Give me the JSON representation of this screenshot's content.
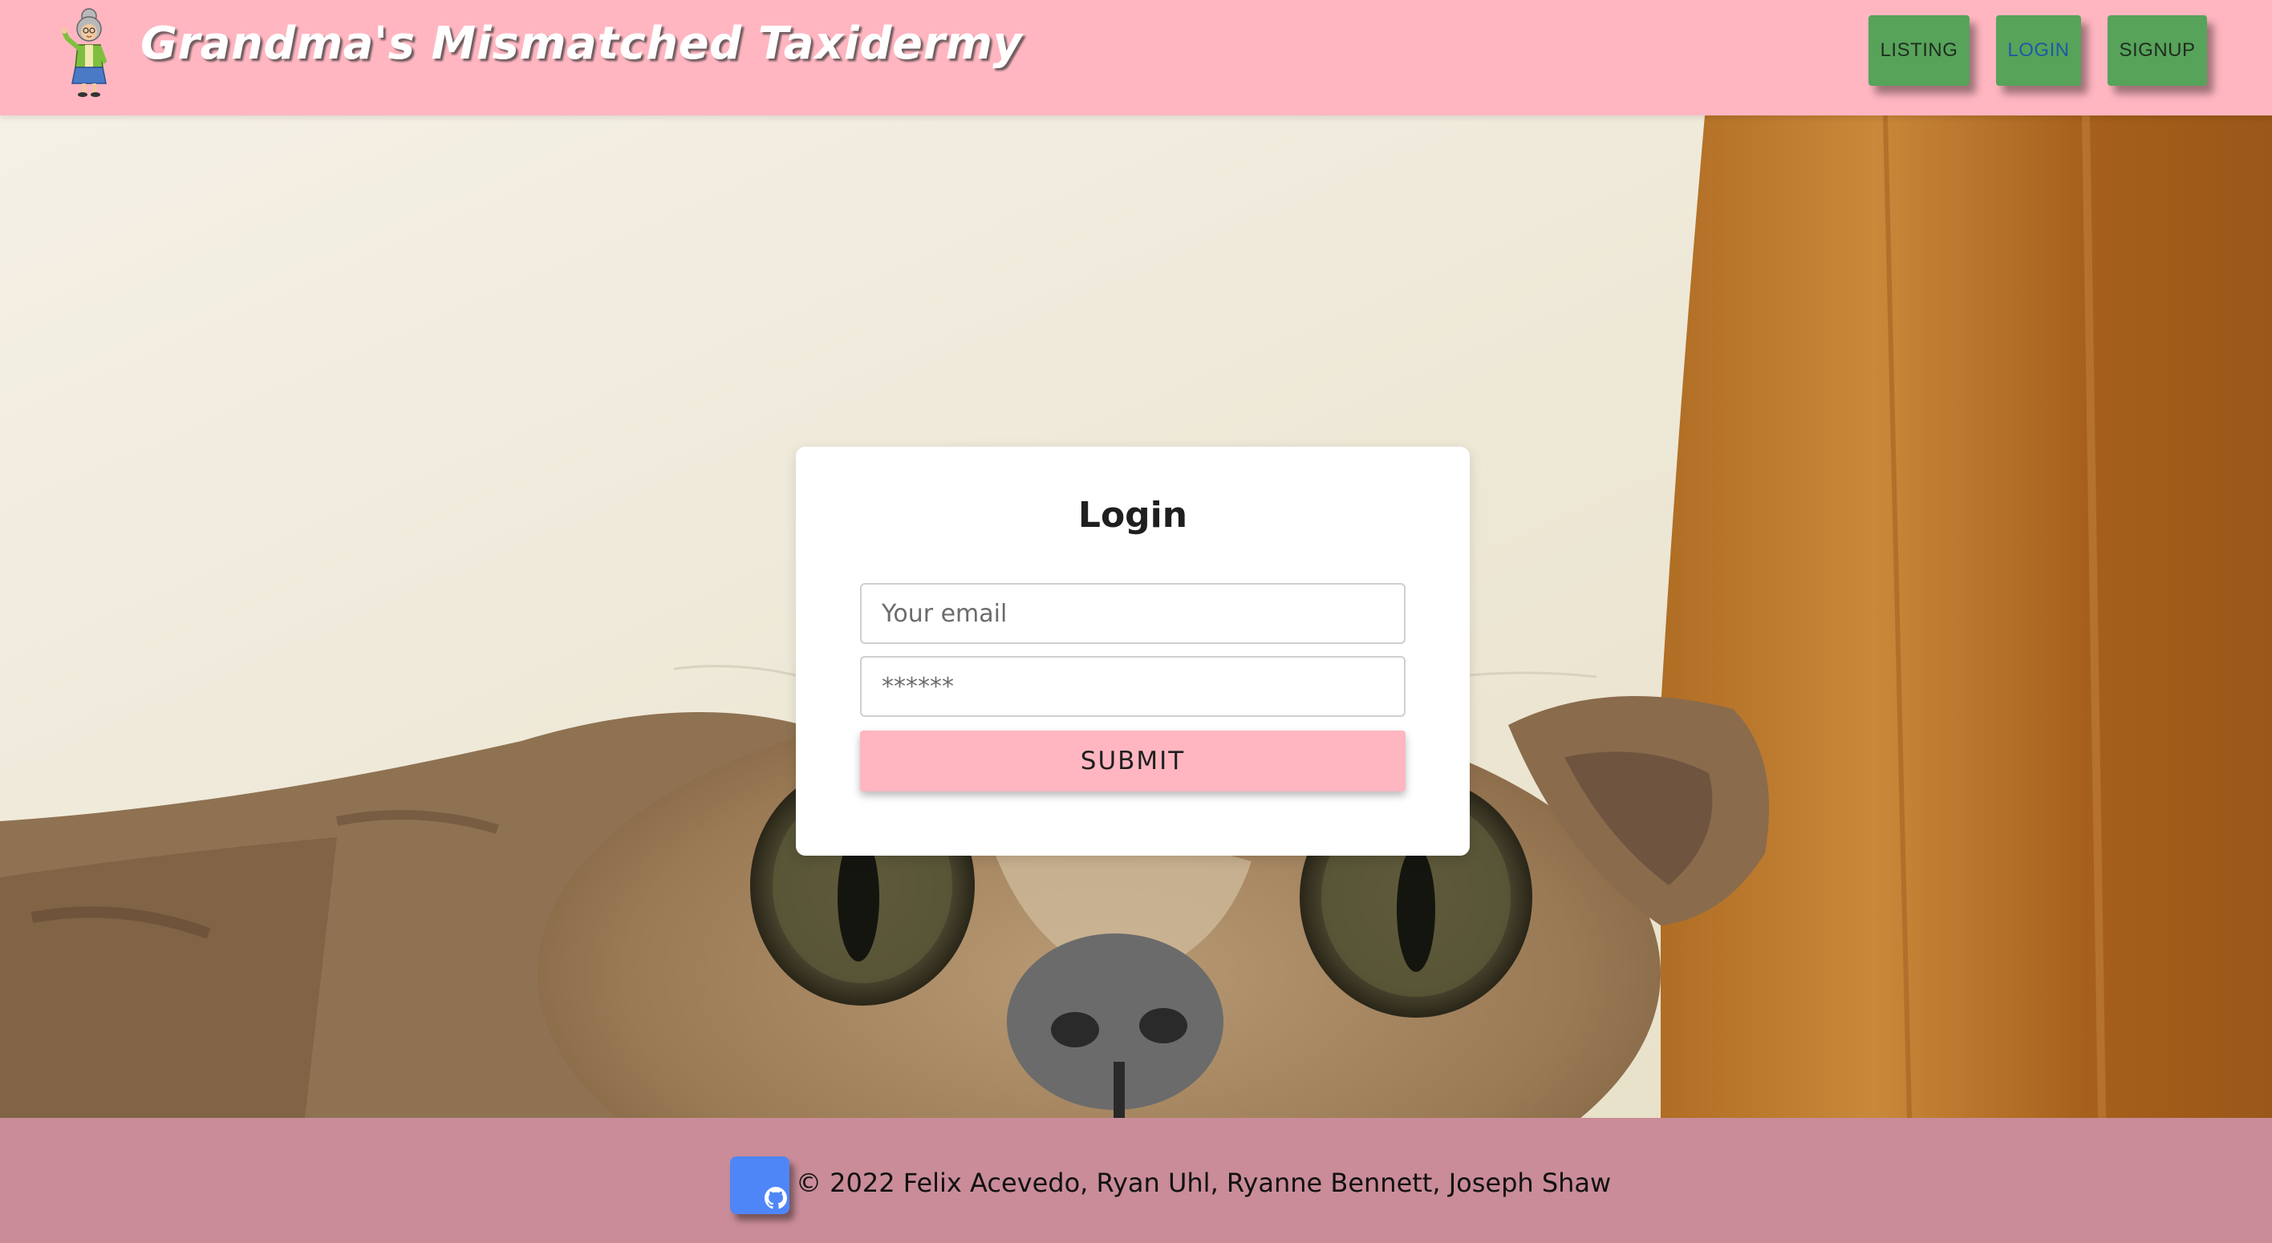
{
  "header": {
    "site_title": "Grandma's Mismatched Taxidermy",
    "logo_icon": "grandma-cartoon-icon",
    "nav": [
      {
        "label": "LISTING",
        "active": false
      },
      {
        "label": "LOGIN",
        "active": true
      },
      {
        "label": "SIGNUP",
        "active": false
      }
    ]
  },
  "login_form": {
    "title": "Login",
    "email_placeholder": "Your email",
    "password_placeholder": "******",
    "submit_label": "SUBMIT"
  },
  "footer": {
    "github_icon": "github-icon",
    "copyright": "© 2022 Felix Acevedo, Ryan Uhl, Ryanne Bennett, Joseph Shaw"
  },
  "colors": {
    "header_bg": "#ffb6c1",
    "nav_button_bg": "#57a35a",
    "active_nav_text": "#1e5aa6",
    "submit_bg": "#ffb6c1",
    "footer_bg": "#c98c98",
    "github_button_bg": "#4f86f7"
  }
}
